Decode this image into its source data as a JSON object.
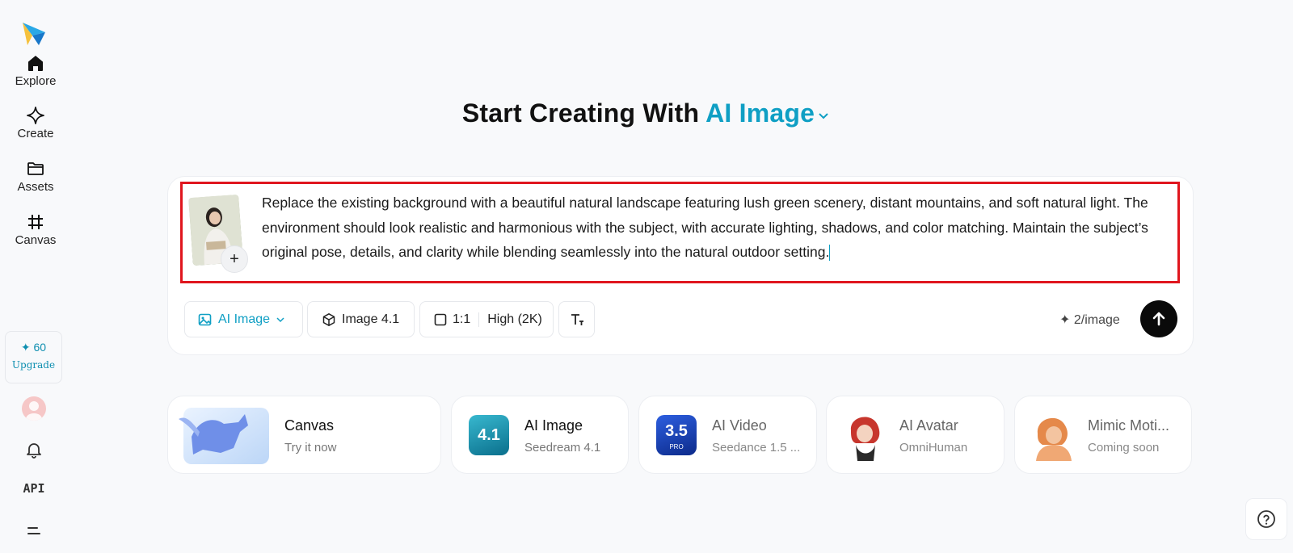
{
  "sidebar": {
    "items": [
      {
        "label": "Explore",
        "icon": "home-icon"
      },
      {
        "label": "Create",
        "icon": "sparkle-icon"
      },
      {
        "label": "Assets",
        "icon": "folder-icon"
      },
      {
        "label": "Canvas",
        "icon": "crop-icon"
      }
    ],
    "credits": {
      "amount": "✦ 60",
      "upgrade_label": "Upgrade"
    },
    "api_label": "API"
  },
  "header": {
    "title_prefix": "Start Creating With",
    "title_accent": "AI Image"
  },
  "prompt": {
    "text": "Replace the existing background with a beautiful natural landscape featuring lush green scenery, distant mountains, and soft natural light. The environment should look realistic and harmonious with the subject, with accurate lighting, shadows, and color matching. Maintain the subject’s original pose, details, and clarity while blending seamlessly into the natural outdoor setting.",
    "add_label": "+"
  },
  "toolbar": {
    "mode_label": "AI Image",
    "model_label": "Image 4.1",
    "ratio_label": "1:1",
    "quality_label": "High (2K)",
    "cost_label": "✦ 2/image"
  },
  "tools": [
    {
      "title": "Canvas",
      "subtitle": "Try it now"
    },
    {
      "title": "AI Image",
      "subtitle": "Seedream 4.1",
      "badge": "4.1"
    },
    {
      "title": "AI Video",
      "subtitle": "Seedance 1.5 ...",
      "badge": "3.5",
      "badge_sub": "PRO"
    },
    {
      "title": "AI Avatar",
      "subtitle": "OmniHuman"
    },
    {
      "title": "Mimic Moti...",
      "subtitle": "Coming soon"
    }
  ],
  "colors": {
    "accent": "#0f9fc4",
    "highlight_border": "#e0161e",
    "send_button": "#0a0a0a"
  }
}
